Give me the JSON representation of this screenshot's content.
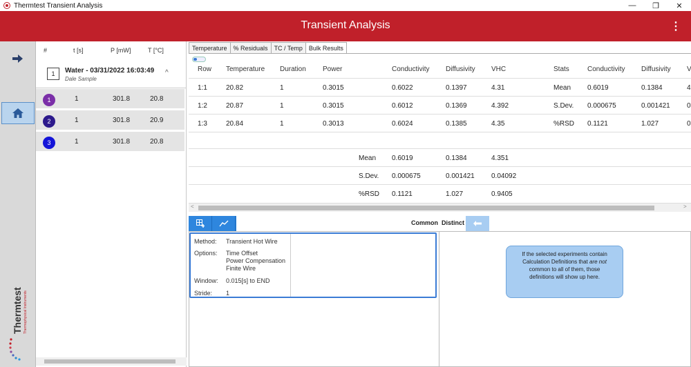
{
  "window": {
    "title": "Thermtest Transient Analysis",
    "minimize": "—",
    "maximize": "❐",
    "close": "✕"
  },
  "header": {
    "title": "Transient Analysis",
    "menu": "⋮"
  },
  "nav": {
    "forward": "➜",
    "logo_text": "Thermtest",
    "logo_sub": "Thermophysical Instruments"
  },
  "list": {
    "headers": {
      "num": "#",
      "t": "t [s]",
      "p": "P [mW]",
      "temp": "T [°C]"
    },
    "sample": {
      "index": "1",
      "name": "Water - 03/31/2022 16:03:49",
      "subtitle": "Dale Sample",
      "chevron": "^"
    },
    "experiments": [
      {
        "num": "1",
        "t": "1",
        "p": "301.8",
        "temp": "20.8",
        "color": "#7b2fa8"
      },
      {
        "num": "2",
        "t": "1",
        "p": "301.8",
        "temp": "20.9",
        "color": "#2d1a8c"
      },
      {
        "num": "3",
        "t": "1",
        "p": "301.8",
        "temp": "20.8",
        "color": "#1515d8"
      }
    ]
  },
  "tabs": [
    "Temperature",
    "% Residuals",
    "TC / Temp",
    "Bulk Results"
  ],
  "grid": {
    "columns": [
      "Row",
      "Temperature",
      "Duration",
      "Power",
      "Conductivity",
      "Diffusivity",
      "VHC",
      "Stats",
      "Conductivity",
      "Diffusivity",
      "V"
    ],
    "rows": [
      {
        "row": "1:1",
        "temperature": "20.82",
        "duration": "1",
        "power": "0.3015",
        "conductivity": "0.6022",
        "diffusivity": "0.1397",
        "vhc": "4.31",
        "stat": "Mean",
        "s_cond": "0.6019",
        "s_diff": "0.1384",
        "s_v": "4"
      },
      {
        "row": "1:2",
        "temperature": "20.87",
        "duration": "1",
        "power": "0.3015",
        "conductivity": "0.6012",
        "diffusivity": "0.1369",
        "vhc": "4.392",
        "stat": "S.Dev.",
        "s_cond": "0.000675",
        "s_diff": "0.001421",
        "s_v": "0"
      },
      {
        "row": "1:3",
        "temperature": "20.84",
        "duration": "1",
        "power": "0.3013",
        "conductivity": "0.6024",
        "diffusivity": "0.1385",
        "vhc": "4.35",
        "stat": "%RSD",
        "s_cond": "0.1121",
        "s_diff": "1.027",
        "s_v": "0"
      }
    ],
    "summary": [
      {
        "label": "Mean",
        "conductivity": "0.6019",
        "diffusivity": "0.1384",
        "vhc": "4.351"
      },
      {
        "label": "S.Dev.",
        "conductivity": "0.000675",
        "diffusivity": "0.001421",
        "vhc": "0.04092"
      },
      {
        "label": "%RSD",
        "conductivity": "0.1121",
        "diffusivity": "1.027",
        "vhc": "0.9405"
      }
    ],
    "scroll_left": "<",
    "scroll_right": ">"
  },
  "bottom": {
    "common_label": "Common",
    "distinct_label": "Distinct",
    "definition": {
      "method_label": "Method:",
      "method": "Transient Hot Wire",
      "options_label": "Options:",
      "options": [
        "Time Offset",
        "Power Compensation",
        "Finite Wire"
      ],
      "window_label": "Window:",
      "window": "0.015[s]  to  END",
      "stride_label": "Stride:",
      "stride": "1"
    },
    "info": {
      "line1": "If the selected experiments contain",
      "line2a": "Calculation Definitions that ",
      "line2b": "are not",
      "line3": "common to all of them, those",
      "line4": "definitions will show up here."
    }
  }
}
